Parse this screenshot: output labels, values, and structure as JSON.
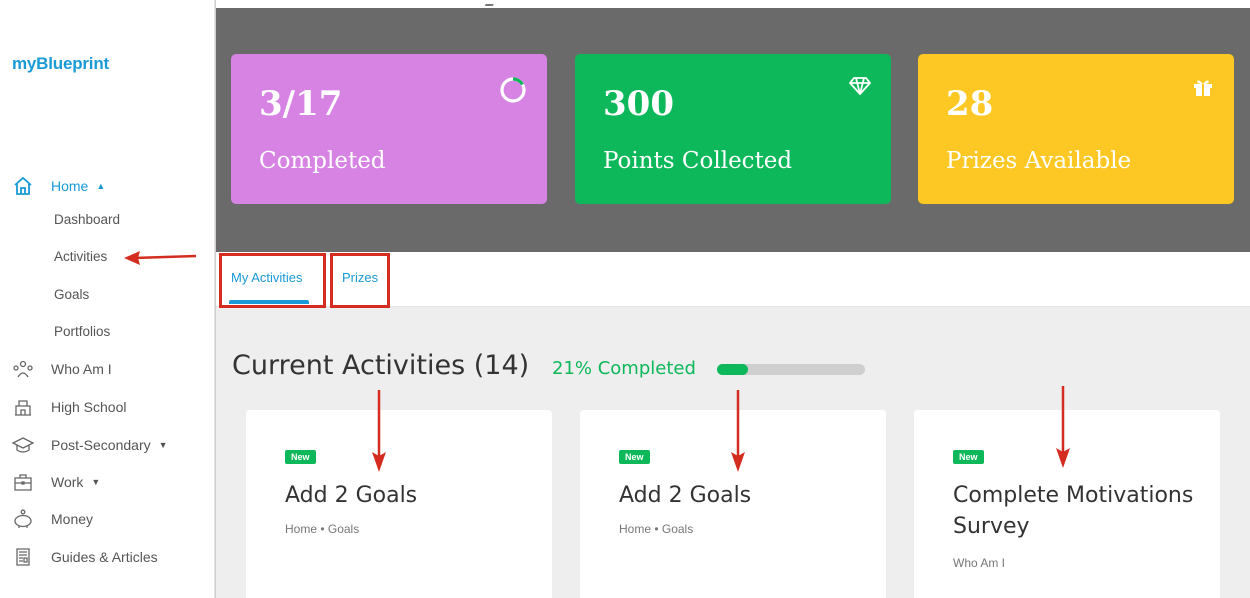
{
  "brand": {
    "name": "myBlueprint"
  },
  "sidebar": {
    "home": {
      "label": "Home",
      "icon": "home-icon"
    },
    "sub_items": [
      {
        "label": "Dashboard"
      },
      {
        "label": "Activities"
      },
      {
        "label": "Goals"
      },
      {
        "label": "Portfolios"
      }
    ],
    "items": [
      {
        "label": "Who Am I",
        "icon": "people-icon"
      },
      {
        "label": "High School",
        "icon": "school-icon"
      },
      {
        "label": "Post-Secondary",
        "icon": "graduation-cap-icon"
      },
      {
        "label": "Work",
        "icon": "briefcase-icon"
      },
      {
        "label": "Money",
        "icon": "piggy-bank-icon"
      },
      {
        "label": "Guides & Articles",
        "icon": "newspaper-icon"
      }
    ]
  },
  "stats": [
    {
      "value": "3/17",
      "label": "Completed",
      "icon": "progress-ring-icon",
      "color": "#d683e4"
    },
    {
      "value": "300",
      "label": "Points Collected",
      "icon": "diamond-icon",
      "color": "#0cb85a"
    },
    {
      "value": "28",
      "label": "Prizes Available",
      "icon": "gift-icon",
      "color": "#fdc823"
    }
  ],
  "tabs": [
    {
      "label": "My Activities"
    },
    {
      "label": "Prizes"
    }
  ],
  "current": {
    "title": "Current Activities (14)",
    "percent_label": "21% Completed",
    "progress": 0.21
  },
  "activities": [
    {
      "badge": "New",
      "title": "Add 2 Goals",
      "breadcrumb": "Home • Goals"
    },
    {
      "badge": "New",
      "title": "Add 2 Goals",
      "breadcrumb": "Home • Goals"
    },
    {
      "badge": "New",
      "title": "Complete Motivations Survey",
      "breadcrumb": "Who Am I"
    }
  ],
  "colors": {
    "accent": "#1a9ad6",
    "annotation": "#d42d1f",
    "success": "#0cb85a"
  }
}
